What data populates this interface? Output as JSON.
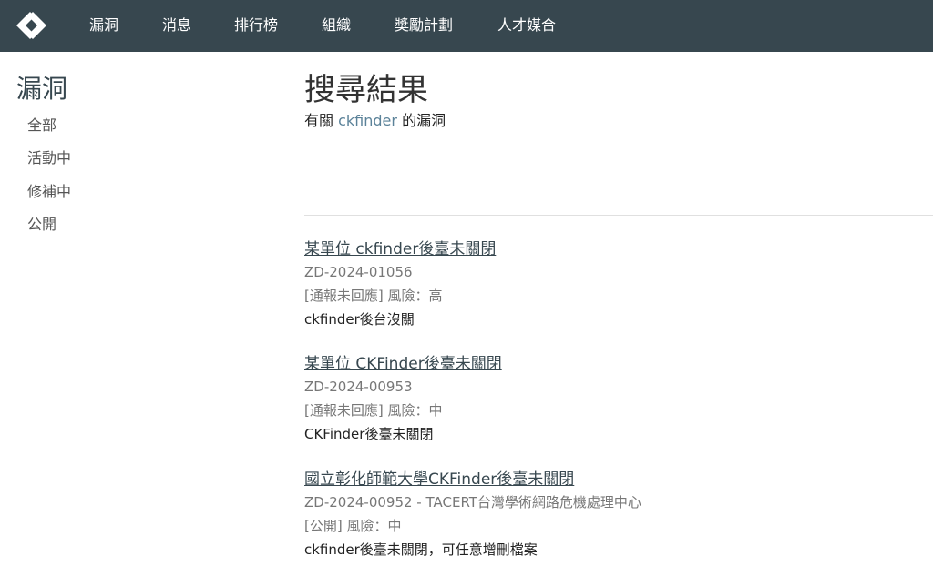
{
  "nav": {
    "items": [
      "漏洞",
      "消息",
      "排行榜",
      "組織",
      "獎勵計劃",
      "人才媒合"
    ]
  },
  "sidebar": {
    "title": "漏洞",
    "links": [
      "全部",
      "活動中",
      "修補中",
      "公開"
    ]
  },
  "main": {
    "title": "搜尋結果",
    "subtitle_prefix": "有關",
    "keyword": "ckfinder",
    "subtitle_suffix": "的漏洞",
    "results": [
      {
        "title": "某單位 ckfinder後臺未關閉",
        "meta": "ZD-2024-01056",
        "status": "[通報未回應] 風險：高",
        "description": "ckfinder後台沒關"
      },
      {
        "title": "某單位 CKFinder後臺未關閉",
        "meta": "ZD-2024-00953",
        "status": "[通報未回應] 風險：中",
        "description": "CKFinder後臺未關閉"
      },
      {
        "title": "國立彰化師範大學CKFinder後臺未關閉",
        "meta": "ZD-2024-00952 - TACERT台灣學術網路危機處理中心",
        "status": "[公開] 風險：中",
        "description": "ckfinder後臺未關閉，可任意增刪檔案"
      }
    ]
  },
  "colors": {
    "navbar_bg": "#37474f",
    "keyword": "#5b8299"
  },
  "icons": {
    "logo": "diamond-arrow-logo-icon"
  }
}
